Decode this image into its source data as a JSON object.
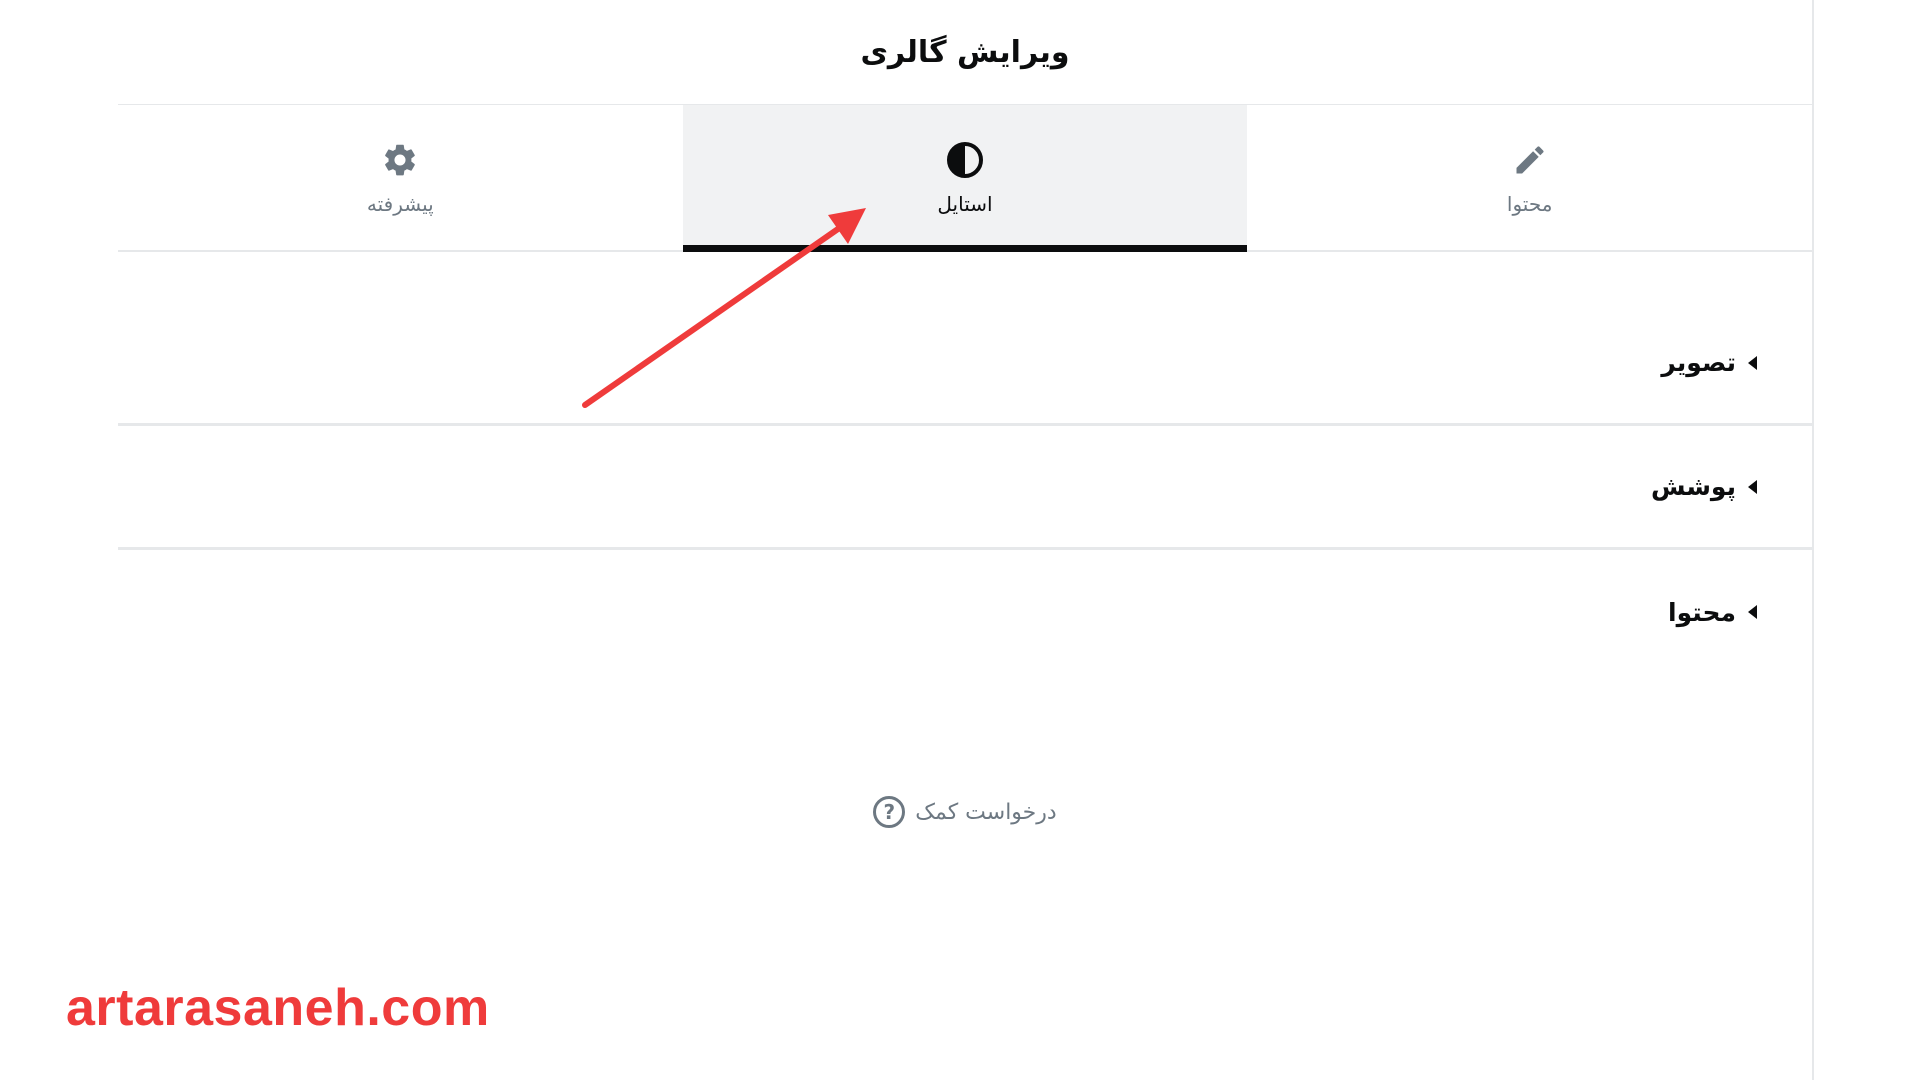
{
  "panel": {
    "title": "ویرایش گالری"
  },
  "tabs": [
    {
      "label": "محتوا",
      "icon": "pencil-icon",
      "active": false
    },
    {
      "label": "استایل",
      "icon": "half-circle-icon",
      "active": true
    },
    {
      "label": "پیشرفته",
      "icon": "gear-icon",
      "active": false
    }
  ],
  "sections": [
    {
      "title": "تصویر"
    },
    {
      "title": "پوشش"
    },
    {
      "title": "محتوا"
    }
  ],
  "help": {
    "label": "درخواست کمک",
    "icon": "question-circle-icon"
  },
  "annotation": {
    "arrow_color": "#ef3b3b"
  },
  "watermark": {
    "text": "artarasaneh.com",
    "color": "#ef3b3b"
  }
}
